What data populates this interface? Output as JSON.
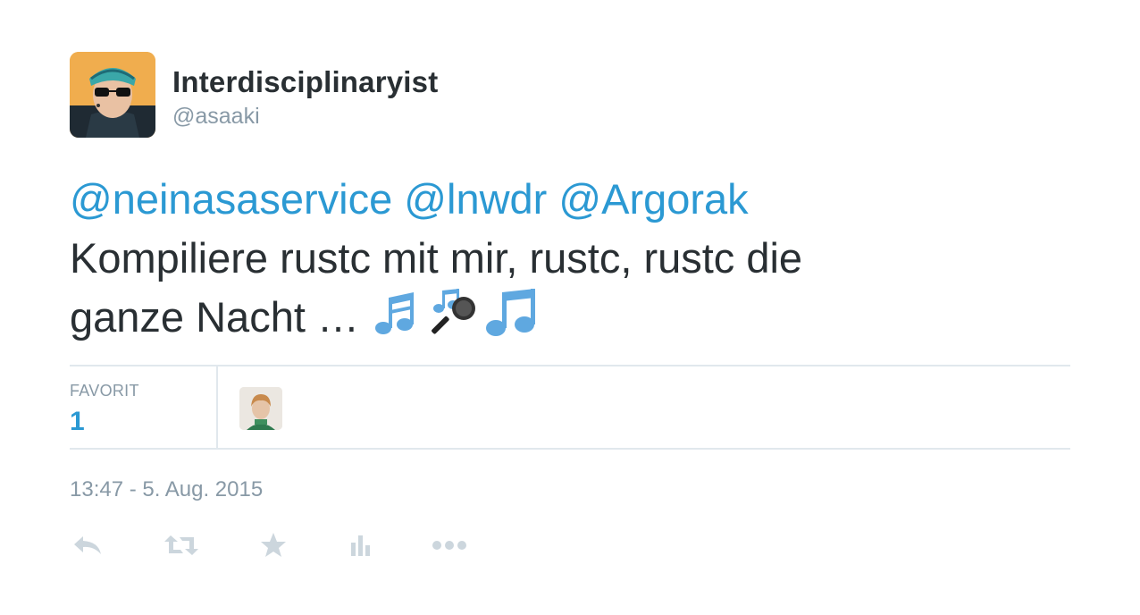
{
  "author": {
    "display_name": "Interdisciplinaryist",
    "handle": "@asaaki"
  },
  "tweet": {
    "mentions": [
      "@neinasaservice",
      "@lnwdr",
      "@Argorak"
    ],
    "text_line1": "Kompiliere rustc mit mir, rustc, rustc die",
    "text_line2": "ganze Nacht …"
  },
  "stats": {
    "favorites_label": "FAVORIT",
    "favorites_count": "1"
  },
  "timestamp": "13:47 - 5. Aug. 2015",
  "actions": [
    "reply-icon",
    "retweet-icon",
    "favorite-icon",
    "analytics-icon",
    "more-icon"
  ],
  "colors": {
    "link": "#2b99d3",
    "text": "#292f33",
    "muted": "#8899a6",
    "border": "#e1e8ed",
    "icon": "#ccd6dd"
  }
}
